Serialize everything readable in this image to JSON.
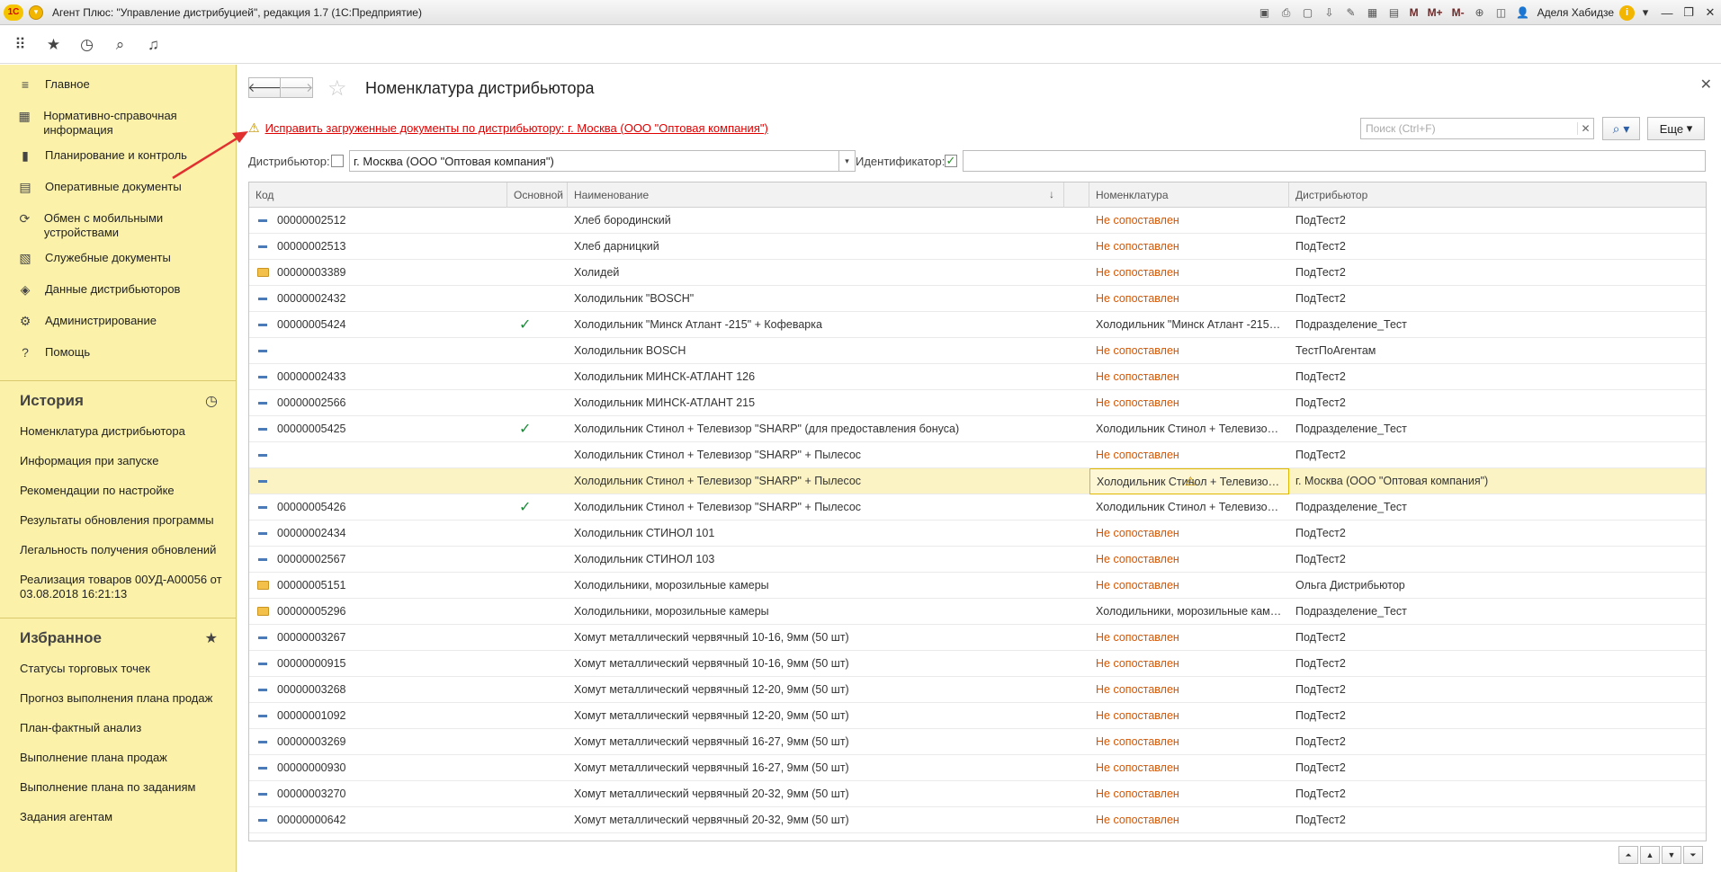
{
  "window": {
    "logo_text": "1С",
    "title": "Агент Плюс: \"Управление дистрибуцией\", редакция 1.7  (1С:Предприятие)",
    "user": "Аделя Хабидзе",
    "icons": [
      "save-icon",
      "print-icon",
      "preview-icon",
      "attach-icon",
      "edit-icon",
      "table-icon",
      "calendar-icon"
    ],
    "memory_buttons": [
      "M",
      "M+",
      "M-"
    ]
  },
  "toolbar": {
    "icons": [
      "apps-grid-icon",
      "favorites-star-icon",
      "history-icon",
      "search-icon",
      "notifications-bell-icon"
    ]
  },
  "sidebar": {
    "menu": [
      {
        "icon": "≡",
        "label": "Главное"
      },
      {
        "icon": "▦",
        "label": "Нормативно-справочная информация"
      },
      {
        "icon": "▮",
        "label": "Планирование и контроль"
      },
      {
        "icon": "▤",
        "label": "Оперативные документы"
      },
      {
        "icon": "⟳",
        "label": "Обмен с мобильными устройствами"
      },
      {
        "icon": "▧",
        "label": "Служебные документы"
      },
      {
        "icon": "◈",
        "label": "Данные дистрибьюторов"
      },
      {
        "icon": "⚙",
        "label": "Администрирование"
      },
      {
        "icon": "?",
        "label": "Помощь"
      }
    ],
    "history": {
      "title": "История",
      "items": [
        "Номенклатура дистрибьютора",
        "Информация при запуске",
        "Рекомендации по настройке",
        "Результаты обновления программы",
        "Легальность получения обновлений",
        "Реализация товаров 00УД-А00056 от 03.08.2018 16:21:13"
      ]
    },
    "favorites": {
      "title": "Избранное",
      "items": [
        "Статусы торговых точек",
        "Прогноз выполнения плана продаж",
        "План-фактный анализ",
        "Выполнение плана продаж",
        "Выполнение плана по заданиям",
        "Задания агентам"
      ]
    }
  },
  "page": {
    "title": "Номенклатура дистрибьютора",
    "warning_link": "Исправить загруженные документы по дистрибьютору: г. Москва  (ООО \"Оптовая компания\")",
    "search_placeholder": "Поиск (Ctrl+F)",
    "more_label": "Еще",
    "filter": {
      "distributor_label": "Дистрибьютор:",
      "distributor_value": "г. Москва  (ООО \"Оптовая компания\")",
      "identifier_label": "Идентификатор:",
      "identifier_checked": true,
      "identifier_value": ""
    }
  },
  "table": {
    "columns": {
      "code": "Код",
      "main": "Основной",
      "name": "Наименование",
      "nomenclature": "Номенклатура",
      "distributor": "Дистрибьютор"
    },
    "rows": [
      {
        "type": "item",
        "code": "00000002512",
        "main": false,
        "name": "Хлеб бородинский",
        "nomenclature": "Не сопоставлен",
        "matched": false,
        "distributor": "ПодТест2"
      },
      {
        "type": "item",
        "code": "00000002513",
        "main": false,
        "name": "Хлеб дарницкий",
        "nomenclature": "Не сопоставлен",
        "matched": false,
        "distributor": "ПодТест2"
      },
      {
        "type": "folder",
        "code": "00000003389",
        "main": false,
        "name": "Холидей",
        "nomenclature": "Не сопоставлен",
        "matched": false,
        "distributor": "ПодТест2"
      },
      {
        "type": "item",
        "code": "00000002432",
        "main": false,
        "name": "Холодильник \"BOSCH\"",
        "nomenclature": "Не сопоставлен",
        "matched": false,
        "distributor": "ПодТест2"
      },
      {
        "type": "item",
        "code": "00000005424",
        "main": true,
        "name": "Холодильник \"Минск Атлант -215\" + Кофеварка",
        "nomenclature": "Холодильник \"Минск Атлант -215\" + Коф...",
        "matched": true,
        "distributor": "Подразделение_Тест"
      },
      {
        "type": "item",
        "code": "",
        "main": false,
        "name": "Холодильник BOSCH",
        "nomenclature": "Не сопоставлен",
        "matched": false,
        "distributor": "ТестПоАгентам"
      },
      {
        "type": "item",
        "code": "00000002433",
        "main": false,
        "name": "Холодильник МИНСК-АТЛАНТ 126",
        "nomenclature": "Не сопоставлен",
        "matched": false,
        "distributor": "ПодТест2"
      },
      {
        "type": "item",
        "code": "00000002566",
        "main": false,
        "name": "Холодильник МИНСК-АТЛАНТ 215",
        "nomenclature": "Не сопоставлен",
        "matched": false,
        "distributor": "ПодТест2"
      },
      {
        "type": "item",
        "code": "00000005425",
        "main": true,
        "name": "Холодильник Стинол + Телевизор \"SHARP\" (для предоставления бонуса)",
        "nomenclature": "Холодильник Стинол + Телевизор \"SHA...",
        "matched": true,
        "distributor": "Подразделение_Тест"
      },
      {
        "type": "item",
        "code": "",
        "main": false,
        "name": "Холодильник Стинол + Телевизор \"SHARP\" + Пылесос",
        "nomenclature": "Не сопоставлен",
        "matched": false,
        "distributor": "ПодТест2"
      },
      {
        "type": "item",
        "code": "",
        "main": false,
        "selected": true,
        "warning": true,
        "name": "Холодильник Стинол + Телевизор \"SHARP\" + Пылесос",
        "nomenclature": "Холодильник Стинол + Телевизор \"SHA...",
        "matched": true,
        "distributor": "г. Москва  (ООО \"Оптовая компания\")"
      },
      {
        "type": "item",
        "code": "00000005426",
        "main": true,
        "name": "Холодильник Стинол + Телевизор \"SHARP\" + Пылесос",
        "nomenclature": "Холодильник Стинол + Телевизор \"SHA...",
        "matched": true,
        "distributor": "Подразделение_Тест"
      },
      {
        "type": "item",
        "code": "00000002434",
        "main": false,
        "name": "Холодильник СТИНОЛ 101",
        "nomenclature": "Не сопоставлен",
        "matched": false,
        "distributor": "ПодТест2"
      },
      {
        "type": "item",
        "code": "00000002567",
        "main": false,
        "name": "Холодильник СТИНОЛ 103",
        "nomenclature": "Не сопоставлен",
        "matched": false,
        "distributor": "ПодТест2"
      },
      {
        "type": "folder",
        "code": "00000005151",
        "main": false,
        "name": "Холодильники, морозильные камеры",
        "nomenclature": "Не сопоставлен",
        "matched": false,
        "distributor": "Ольга Дистрибьютор"
      },
      {
        "type": "folder",
        "code": "00000005296",
        "main": false,
        "name": "Холодильники, морозильные камеры",
        "nomenclature": "Холодильники, морозильные камеры",
        "matched": true,
        "distributor": "Подразделение_Тест"
      },
      {
        "type": "item",
        "code": "00000003267",
        "main": false,
        "name": "Хомут металлический червячный 10-16, 9мм (50 шт)",
        "nomenclature": "Не сопоставлен",
        "matched": false,
        "distributor": "ПодТест2"
      },
      {
        "type": "item",
        "code": "00000000915",
        "main": false,
        "name": "Хомут металлический червячный 10-16, 9мм (50 шт)",
        "nomenclature": "Не сопоставлен",
        "matched": false,
        "distributor": "ПодТест2"
      },
      {
        "type": "item",
        "code": "00000003268",
        "main": false,
        "name": "Хомут металлический червячный 12-20, 9мм (50 шт)",
        "nomenclature": "Не сопоставлен",
        "matched": false,
        "distributor": "ПодТест2"
      },
      {
        "type": "item",
        "code": "00000001092",
        "main": false,
        "name": "Хомут металлический червячный 12-20, 9мм (50 шт)",
        "nomenclature": "Не сопоставлен",
        "matched": false,
        "distributor": "ПодТест2"
      },
      {
        "type": "item",
        "code": "00000003269",
        "main": false,
        "name": "Хомут металлический червячный 16-27, 9мм (50 шт)",
        "nomenclature": "Не сопоставлен",
        "matched": false,
        "distributor": "ПодТест2"
      },
      {
        "type": "item",
        "code": "00000000930",
        "main": false,
        "name": "Хомут металлический червячный 16-27, 9мм (50 шт)",
        "nomenclature": "Не сопоставлен",
        "matched": false,
        "distributor": "ПодТест2"
      },
      {
        "type": "item",
        "code": "00000003270",
        "main": false,
        "name": "Хомут металлический червячный 20-32, 9мм (50 шт)",
        "nomenclature": "Не сопоставлен",
        "matched": false,
        "distributor": "ПодТест2"
      },
      {
        "type": "item",
        "code": "00000000642",
        "main": false,
        "name": "Хомут металлический червячный 20-32, 9мм (50 шт)",
        "nomenclature": "Не сопоставлен",
        "matched": false,
        "distributor": "ПодТест2"
      }
    ]
  },
  "colors": {
    "sidebar_bg": "#fbf1a9",
    "unmatched_text": "#d45500",
    "warning_link": "#e00000",
    "selected_row": "#fbf3c4",
    "check": "#1e8a3a",
    "annotation_arrow": "#e03030"
  }
}
